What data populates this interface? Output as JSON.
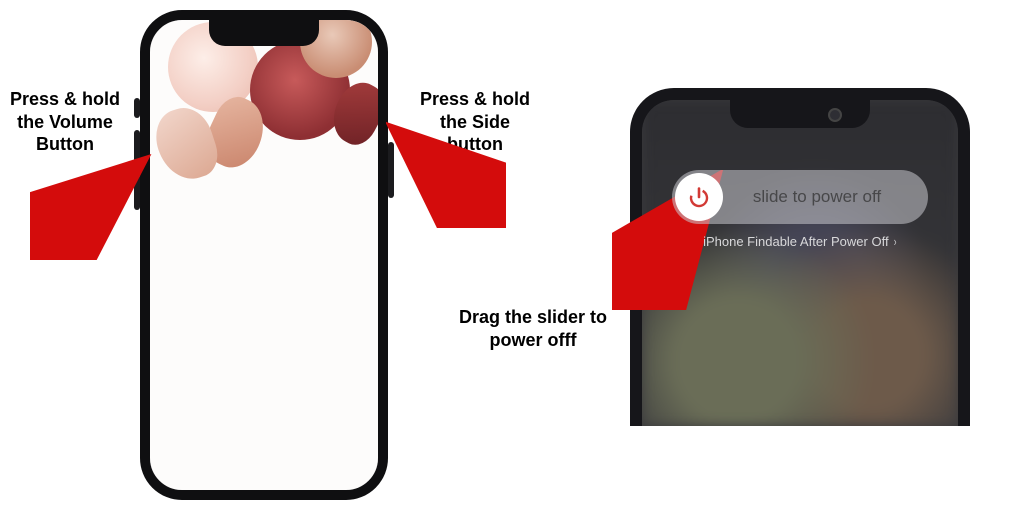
{
  "labels": {
    "volume": "Press & hold\nthe Volume\nButton",
    "side": "Press & hold\nthe Side button",
    "drag": "Drag the slider to\npower offf"
  },
  "phone2": {
    "slider_text": "slide to power off",
    "findable_text": "iPhone Findable After Power Off",
    "findable_chevron": "›"
  },
  "icons": {
    "power": "power-icon"
  },
  "colors": {
    "arrow": "#d40c0c",
    "power_icon": "#d23a35"
  }
}
